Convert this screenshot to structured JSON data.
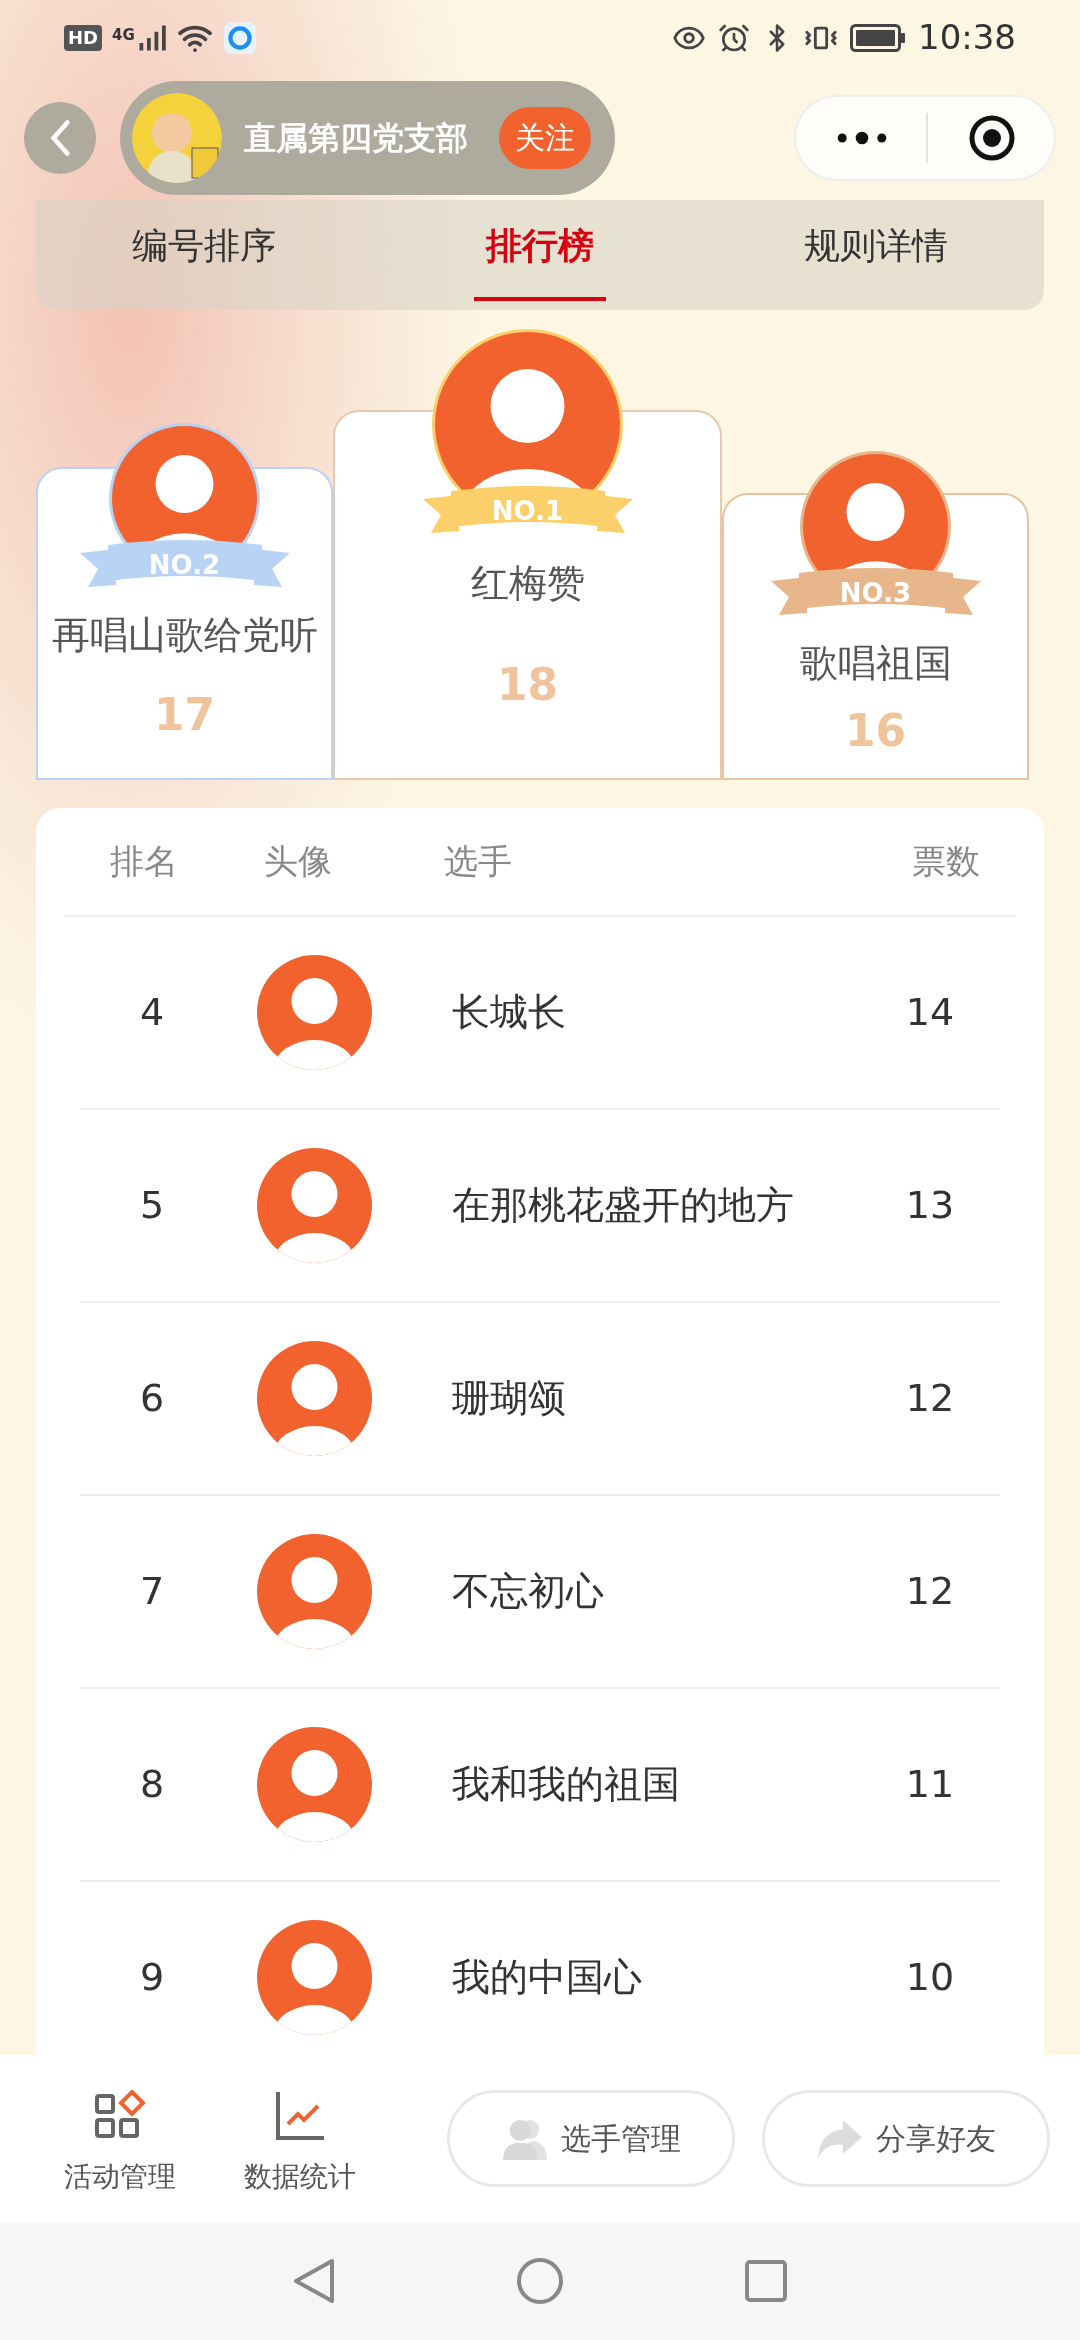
{
  "status_bar": {
    "hd": "HD",
    "network": "4G",
    "time": "10:38"
  },
  "header": {
    "title": "直属第四党支部",
    "follow": "关注"
  },
  "tabs": [
    {
      "label": "编号排序",
      "selected": false
    },
    {
      "label": "排行榜",
      "selected": true
    },
    {
      "label": "规则详情",
      "selected": false
    }
  ],
  "podium": [
    {
      "kind": "second",
      "badge": "NO.2",
      "name": "再唱山歌给党听",
      "votes": "17",
      "color": "#b9d3f4"
    },
    {
      "kind": "first",
      "badge": "NO.1",
      "name": "红梅赞",
      "votes": "18",
      "color": "#fbd06a"
    },
    {
      "kind": "third",
      "badge": "NO.3",
      "name": "歌唱祖国",
      "votes": "16",
      "color": "#e8b68b"
    }
  ],
  "table": {
    "columns": [
      "排名",
      "头像",
      "选手",
      "票数"
    ],
    "rows": [
      {
        "rank": "4",
        "name": "长城长",
        "votes": "14"
      },
      {
        "rank": "5",
        "name": "在那桃花盛开的地方",
        "votes": "13"
      },
      {
        "rank": "6",
        "name": "珊瑚颂",
        "votes": "12"
      },
      {
        "rank": "7",
        "name": "不忘初心",
        "votes": "12"
      },
      {
        "rank": "8",
        "name": "我和我的祖国",
        "votes": "11"
      },
      {
        "rank": "9",
        "name": "我的中国心",
        "votes": "10"
      }
    ]
  },
  "toolbar": [
    {
      "kind": "activity",
      "label": "活动管理"
    },
    {
      "kind": "stats",
      "label": "数据统计"
    }
  ],
  "actions": [
    {
      "kind": "players",
      "label": "选手管理"
    },
    {
      "kind": "share",
      "label": "分享好友"
    }
  ]
}
